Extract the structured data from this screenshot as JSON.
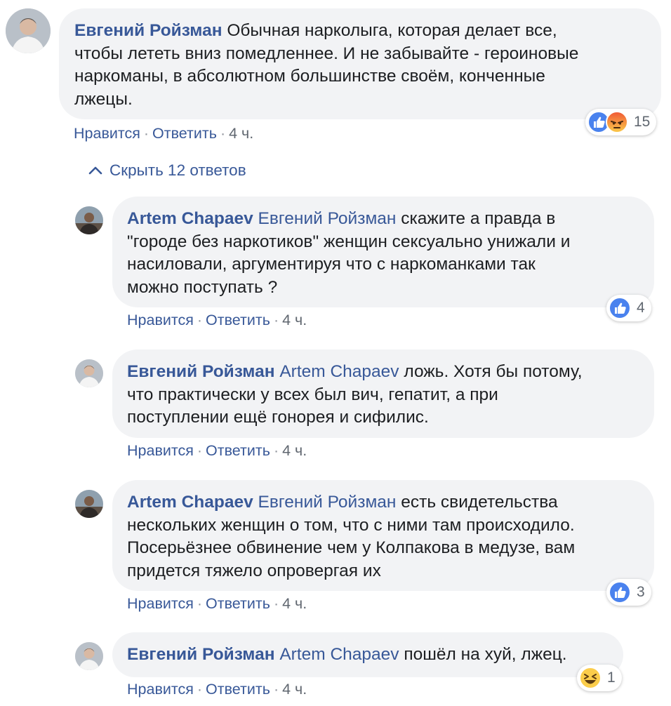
{
  "colors": {
    "link": "#385898",
    "bubble": "#f2f3f5",
    "like_blue": "#4a82ee",
    "angry_orange": "#f25f3b"
  },
  "main_comment": {
    "author": "Евгений Ройзман",
    "text_lines": [
      " Обычная нарколыга, которая делает все,",
      "чтобы лететь вниз помедленнее. И не забывайте - героиновые",
      "наркоманы, в абсолютном большинстве своём, конченные",
      "лжецы."
    ],
    "like_label": "Нравится",
    "reply_label": "Ответить",
    "time": "4 ч.",
    "reaction_icons": [
      "like-icon",
      "angry-icon"
    ],
    "reaction_count": "15"
  },
  "hide_replies": {
    "icon": "chevron-up-icon",
    "label": "Скрыть 12 ответов"
  },
  "replies": [
    {
      "author": "Artem Chapaev",
      "mention": "Евгений Ройзман",
      "text_lines": [
        " скажите а правда в",
        "\"городе без наркотиков\" женщин сексуально унижали и",
        "насиловали, аргументируя что с наркоманками так",
        "можно поступать ?"
      ],
      "like_label": "Нравится",
      "reply_label": "Ответить",
      "time": "4 ч.",
      "reaction_icons": [
        "like-icon"
      ],
      "reaction_count": "4"
    },
    {
      "author": "Евгений Ройзман",
      "mention": "Artem Chapaev",
      "text_lines": [
        " ложь. Хотя бы потому,",
        "что практически у всех был вич, гепатит, а при",
        "поступлении ещё гонорея и сифилис."
      ],
      "like_label": "Нравится",
      "reply_label": "Ответить",
      "time": "4 ч."
    },
    {
      "author": "Artem Chapaev",
      "mention": "Евгений Ройзман",
      "text_lines": [
        " есть свидетельства",
        "нескольких женщин о том, что с ними там происходило.",
        "Посерьёзнее обвинение чем у Колпакова в медузе, вам",
        "придется тяжело опровергая их"
      ],
      "like_label": "Нравится",
      "reply_label": "Ответить",
      "time": "4 ч.",
      "reaction_icons": [
        "like-icon"
      ],
      "reaction_count": "3"
    },
    {
      "author": "Евгений Ройзман",
      "mention": "Artem Chapaev",
      "text_lines": [
        " пошёл на хуй, лжец."
      ],
      "like_label": "Нравится",
      "reply_label": "Ответить",
      "time": "4 ч.",
      "reaction_icons": [
        "haha-icon"
      ],
      "reaction_count": "1"
    }
  ]
}
